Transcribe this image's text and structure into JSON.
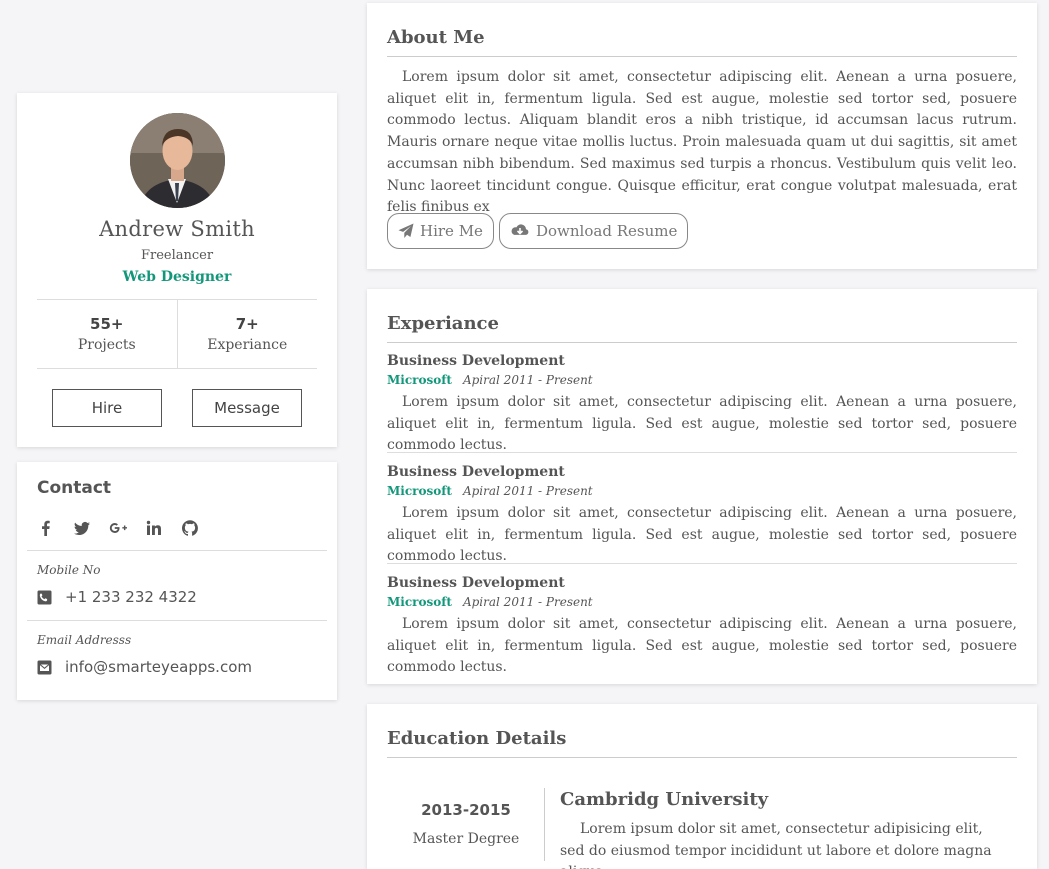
{
  "profile": {
    "name": "Andrew Smith",
    "role": "Freelancer",
    "title": "Web Designer",
    "stats": [
      {
        "value": "55+",
        "label": "Projects"
      },
      {
        "value": "7+",
        "label": "Experiance"
      }
    ],
    "hire_label": "Hire",
    "message_label": "Message"
  },
  "contact": {
    "title": "Contact",
    "socials": [
      "facebook-icon",
      "twitter-icon",
      "google-plus-icon",
      "linkedin-icon",
      "github-icon"
    ],
    "mobile_label": "Mobile No",
    "mobile_value": "+1 233 232 4322",
    "email_label": "Email Addresss",
    "email_value": "info@smarteyeapps.com"
  },
  "about": {
    "title": "About Me",
    "text": "Lorem ipsum dolor sit amet, consectetur adipiscing elit. Aenean a urna posuere, aliquet elit in, fermentum ligula. Sed est augue, molestie sed tortor sed, posuere commodo lectus. Aliquam blandit eros a nibh tristique, id accumsan lacus rutrum. Mauris ornare neque vitae mollis luctus. Proin malesuada quam ut dui sagittis, sit amet accumsan nibh bibendum. Sed maximus sed turpis a rhoncus. Vestibulum quis velit leo. Nunc laoreet tincidunt congue. Quisque efficitur, erat congue volutpat malesuada, erat felis finibus ex",
    "hire_label": "Hire Me",
    "download_label": "Download Resume"
  },
  "experience": {
    "title": "Experiance",
    "items": [
      {
        "title": "Business Development",
        "company": "Microsoft",
        "date": "Apiral 2011 - Present",
        "desc": "Lorem ipsum dolor sit amet, consectetur adipiscing elit. Aenean a urna posuere, aliquet elit in, fermentum ligula. Sed est augue, molestie sed tortor sed, posuere commodo lectus."
      },
      {
        "title": "Business Development",
        "company": "Microsoft",
        "date": "Apiral 2011 - Present",
        "desc": "Lorem ipsum dolor sit amet, consectetur adipiscing elit. Aenean a urna posuere, aliquet elit in, fermentum ligula. Sed est augue, molestie sed tortor sed, posuere commodo lectus."
      },
      {
        "title": "Business Development",
        "company": "Microsoft",
        "date": "Apiral 2011 - Present",
        "desc": "Lorem ipsum dolor sit amet, consectetur adipiscing elit. Aenean a urna posuere, aliquet elit in, fermentum ligula. Sed est augue, molestie sed tortor sed, posuere commodo lectus."
      }
    ]
  },
  "education": {
    "title": "Education Details",
    "years": "2013-2015",
    "degree": "Master Degree",
    "university": "Cambridg University",
    "desc": "Lorem ipsum dolor sit amet, consectetur adipisicing elit, sed do eiusmod tempor incididunt ut labore et dolore magna aliqua."
  },
  "colors": {
    "accent": "#13977a",
    "background": "#f5f4f7"
  }
}
